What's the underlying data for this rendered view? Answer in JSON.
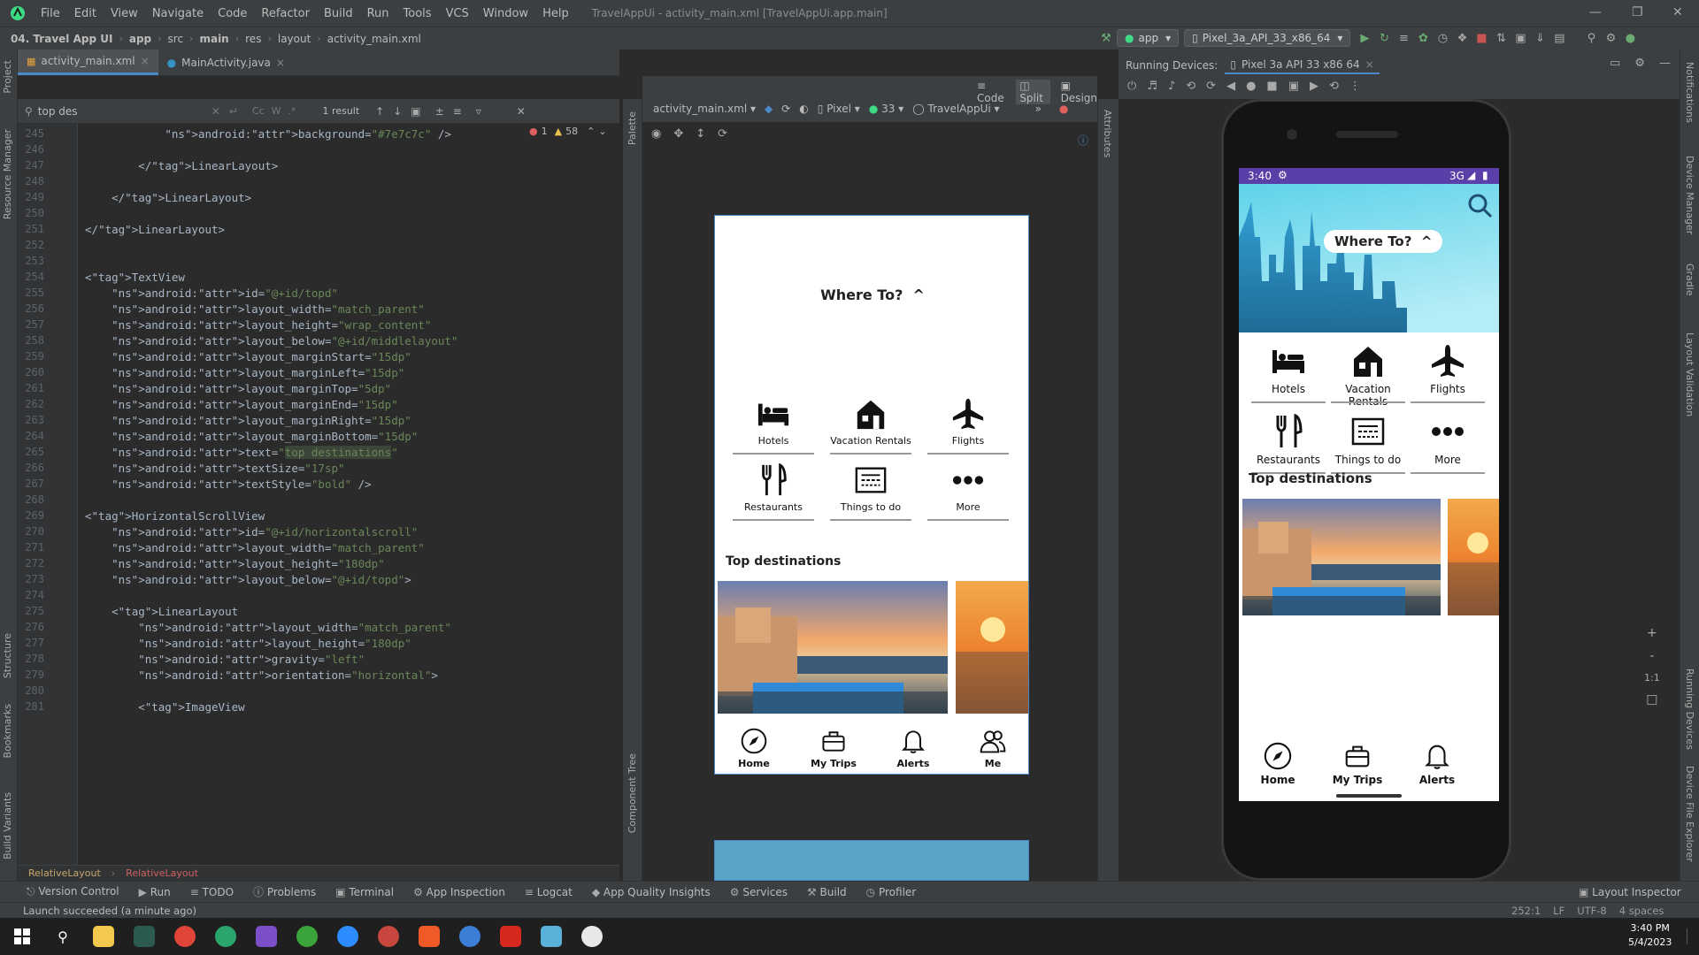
{
  "menu": [
    "File",
    "Edit",
    "View",
    "Navigate",
    "Code",
    "Refactor",
    "Build",
    "Run",
    "Tools",
    "VCS",
    "Window",
    "Help"
  ],
  "window_title": "TravelAppUi - activity_main.xml [TravelAppUi.app.main]",
  "breadcrumbs": [
    "04. Travel App UI",
    "app",
    "src",
    "main",
    "res",
    "layout",
    "activity_main.xml"
  ],
  "run_config": "app",
  "device_select": "Pixel_3a_API_33_x86_64",
  "tabs": [
    {
      "label": "activity_main.xml",
      "active": true
    },
    {
      "label": "MainActivity.java",
      "active": false
    }
  ],
  "find": {
    "query": "top des",
    "result": "1 result"
  },
  "inspections": {
    "errors": "1",
    "warnings": "58"
  },
  "code_lines": [
    {
      "n": "245",
      "t": "            android:background=\"#7e7c7c\" />"
    },
    {
      "n": "246",
      "t": ""
    },
    {
      "n": "247",
      "t": "        </LinearLayout>"
    },
    {
      "n": "248",
      "t": ""
    },
    {
      "n": "249",
      "t": "    </LinearLayout>"
    },
    {
      "n": "250",
      "t": ""
    },
    {
      "n": "251",
      "t": "</LinearLayout>"
    },
    {
      "n": "252",
      "t": ""
    },
    {
      "n": "253",
      "t": ""
    },
    {
      "n": "254",
      "t": "<TextView"
    },
    {
      "n": "255",
      "t": "    android:id=\"@+id/topd\""
    },
    {
      "n": "256",
      "t": "    android:layout_width=\"match_parent\""
    },
    {
      "n": "257",
      "t": "    android:layout_height=\"wrap_content\""
    },
    {
      "n": "258",
      "t": "    android:layout_below=\"@+id/middlelayout\""
    },
    {
      "n": "259",
      "t": "    android:layout_marginStart=\"15dp\""
    },
    {
      "n": "260",
      "t": "    android:layout_marginLeft=\"15dp\""
    },
    {
      "n": "261",
      "t": "    android:layout_marginTop=\"5dp\""
    },
    {
      "n": "262",
      "t": "    android:layout_marginEnd=\"15dp\""
    },
    {
      "n": "263",
      "t": "    android:layout_marginRight=\"15dp\""
    },
    {
      "n": "264",
      "t": "    android:layout_marginBottom=\"15dp\""
    },
    {
      "n": "265",
      "t": "    android:text=\"top destinations\""
    },
    {
      "n": "266",
      "t": "    android:textSize=\"17sp\""
    },
    {
      "n": "267",
      "t": "    android:textStyle=\"bold\" />"
    },
    {
      "n": "268",
      "t": ""
    },
    {
      "n": "269",
      "t": "<HorizontalScrollView"
    },
    {
      "n": "270",
      "t": "    android:id=\"@+id/horizontalscroll\""
    },
    {
      "n": "271",
      "t": "    android:layout_width=\"match_parent\""
    },
    {
      "n": "272",
      "t": "    android:layout_height=\"180dp\""
    },
    {
      "n": "273",
      "t": "    android:layout_below=\"@+id/topd\">"
    },
    {
      "n": "274",
      "t": ""
    },
    {
      "n": "275",
      "t": "    <LinearLayout"
    },
    {
      "n": "276",
      "t": "        android:layout_width=\"match_parent\""
    },
    {
      "n": "277",
      "t": "        android:layout_height=\"180dp\""
    },
    {
      "n": "278",
      "t": "        android:gravity=\"left\""
    },
    {
      "n": "279",
      "t": "        android:orientation=\"horizontal\">"
    },
    {
      "n": "280",
      "t": ""
    },
    {
      "n": "281",
      "t": "        <ImageView"
    }
  ],
  "editor_breadcrumb": [
    "RelativeLayout",
    "RelativeLayout"
  ],
  "view_modes": [
    "Code",
    "Split",
    "Design"
  ],
  "design_toolbar": {
    "file": "activity_main.xml",
    "device": "Pixel",
    "api": "33",
    "theme": "TravelAppUi"
  },
  "running_devices": {
    "label": "Running Devices:",
    "device_tab": "Pixel 3a API 33 x86 64"
  },
  "left_tools": [
    "Project",
    "Resource Manager",
    "Structure",
    "Bookmarks",
    "Build Variants"
  ],
  "right_tools": [
    "Notifications",
    "Device Manager",
    "Gradle",
    "Layout Validation",
    "Running Devices",
    "Device File Explorer"
  ],
  "palette_label": "Palette",
  "attributes_label": "Attributes",
  "component_tree_label": "Component Tree",
  "app": {
    "where_to": "Where To?",
    "caret": "^",
    "categories": [
      {
        "label": "Hotels",
        "icon": "bed-icon"
      },
      {
        "label": "Vacation Rentals",
        "icon": "house-icon"
      },
      {
        "label": "Flights",
        "icon": "airplane-icon"
      },
      {
        "label": "Restaurants",
        "icon": "cutlery-icon"
      },
      {
        "label": "Things to do",
        "icon": "ticket-icon"
      },
      {
        "label": "More",
        "icon": "more-icon"
      }
    ],
    "section_title": "Top destinations",
    "bottom_nav": [
      "Home",
      "My Trips",
      "Alerts",
      "Me"
    ],
    "status_time": "3:40",
    "status_network": "3G"
  },
  "bottom_tools": [
    "Version Control",
    "Run",
    "TODO",
    "Problems",
    "Terminal",
    "App Inspection",
    "Logcat",
    "App Quality Insights",
    "Services",
    "Build",
    "Profiler",
    "Layout Inspector"
  ],
  "status": {
    "message": "Launch succeeded (a minute ago)",
    "position": "252:1",
    "line_sep": "LF",
    "encoding": "UTF-8",
    "indent": "4 spaces"
  },
  "zoom_controls": [
    "+",
    "-",
    "1:1"
  ],
  "clock": {
    "time": "3:40 PM",
    "date": "5/4/2023"
  },
  "colors": {
    "accent": "#4a88c7",
    "status_purple": "#5b3fa8",
    "sky_top": "#5fd3e8",
    "sky_bottom": "#9ee6f5",
    "city": "#1f7fb2"
  }
}
